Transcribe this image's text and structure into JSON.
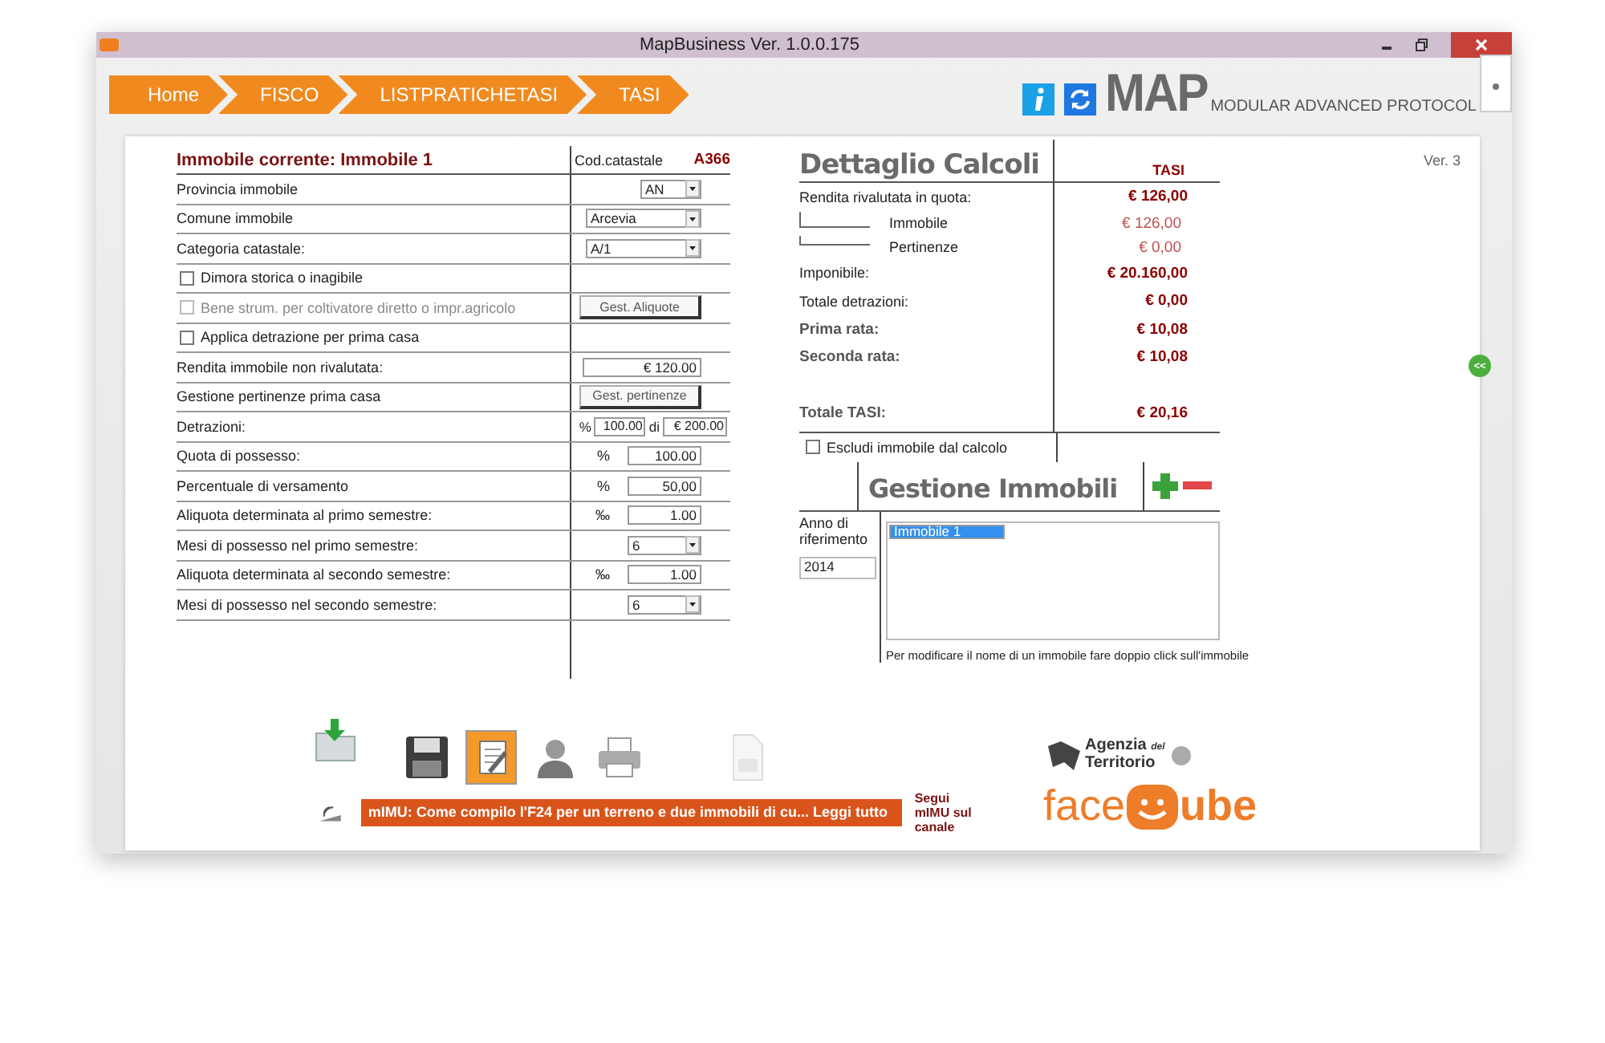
{
  "window": {
    "title": "MapBusiness Ver. 1.0.0.175"
  },
  "breadcrumbs": [
    {
      "label": "Home"
    },
    {
      "label": "FISCO"
    },
    {
      "label": "LISTPRATICHETASI"
    },
    {
      "label": "TASI"
    }
  ],
  "logo": {
    "text": "MAP",
    "subtitle": "MODULAR ADVANCED PROTOCOL"
  },
  "version": "Ver. 3",
  "form": {
    "title": "Immobile corrente: Immobile 1",
    "code_label": "Cod.catastale",
    "code_value": "A366",
    "rows": [
      {
        "kind": "select",
        "label": "Provincia immobile",
        "value": "AN"
      },
      {
        "kind": "select",
        "label": "Comune immobile",
        "value": "Arcevia"
      },
      {
        "kind": "select",
        "label": "Categoria catastale:",
        "value": "A/1"
      },
      {
        "kind": "checkbox",
        "label": "Dimora storica o inagibile",
        "checked": false,
        "disabled": false
      },
      {
        "kind": "checkbox",
        "label": "Bene strum. per coltivatore diretto o impr.agricolo",
        "checked": false,
        "disabled": true,
        "button": "Gest. Aliquote"
      },
      {
        "kind": "checkbox",
        "label": "Applica detrazione per prima casa",
        "checked": false,
        "disabled": false
      },
      {
        "kind": "input",
        "label": "Rendita immobile non rivalutata:",
        "value": "€ 120.00"
      },
      {
        "kind": "button",
        "label": "Gestione pertinenze prima casa",
        "button": "Gest. pertinenze"
      },
      {
        "kind": "detrazioni",
        "label": "Detrazioni:",
        "unit": "%",
        "value": "100.00",
        "joiner": "di",
        "amount": "€ 200.00"
      },
      {
        "kind": "unit",
        "label": "Quota di possesso:",
        "unit": "%",
        "value": "100.00"
      },
      {
        "kind": "unit",
        "label": "Percentuale di versamento",
        "unit": "%",
        "value": "50,00"
      },
      {
        "kind": "unit",
        "label": "Aliquota determinata al primo semestre:",
        "unit": "‰",
        "value": "1.00"
      },
      {
        "kind": "select",
        "label": "Mesi di possesso nel primo semestre:",
        "value": "6"
      },
      {
        "kind": "unit",
        "label": "Aliquota determinata al secondo semestre:",
        "unit": "‰",
        "value": "1.00"
      },
      {
        "kind": "select",
        "label": "Mesi di possesso nel secondo semestre:",
        "value": "6"
      }
    ]
  },
  "details": {
    "title": "Dettaglio Calcoli",
    "column": "TASI",
    "rows": [
      {
        "kind": "main",
        "label": "Rendita rivalutata in quota:",
        "value": "€ 126,00"
      },
      {
        "kind": "sub",
        "label": "Immobile",
        "value": "€ 126,00"
      },
      {
        "kind": "sub",
        "label": "Pertinenze",
        "value": "€ 0,00"
      },
      {
        "kind": "main",
        "label": "Imponibile:",
        "value": "€ 20.160,00"
      },
      {
        "kind": "main",
        "label": "Totale detrazioni:",
        "value": "€ 0,00"
      },
      {
        "kind": "rata",
        "label": "Prima rata:",
        "value": "€ 10,08"
      },
      {
        "kind": "rata",
        "label": "Seconda rata:",
        "value": "€ 10,08"
      },
      {
        "kind": "total",
        "label": "Totale TASI:",
        "value": "€ 20,16"
      }
    ],
    "exclude": {
      "label": "Escludi immobile dal calcolo",
      "checked": false
    }
  },
  "manager": {
    "title": "Gestione Immobili",
    "year_label": "Anno di riferimento",
    "year": "2014",
    "items": [
      {
        "label": "Immobile 1",
        "selected": true
      }
    ],
    "hint": "Per modificare il nome di un immobile fare doppio click sull'immobile"
  },
  "toolbar": [
    {
      "selected": false,
      "disabled": false
    },
    {
      "selected": true,
      "disabled": false
    },
    {
      "selected": false,
      "disabled": false
    },
    {
      "selected": false,
      "disabled": false
    },
    {
      "selected": false,
      "disabled": true
    }
  ],
  "news": {
    "text": "mIMU: Come compilo l'F24 per un terreno e due immobili di cu... Leggi tutto",
    "follow": "Segui mIMU sul canale"
  },
  "agency": {
    "name": "Agenzia",
    "small": "del",
    "name2": "Territorio"
  },
  "brand": {
    "left": "face",
    "right": "ube"
  },
  "collapse": "<<"
}
